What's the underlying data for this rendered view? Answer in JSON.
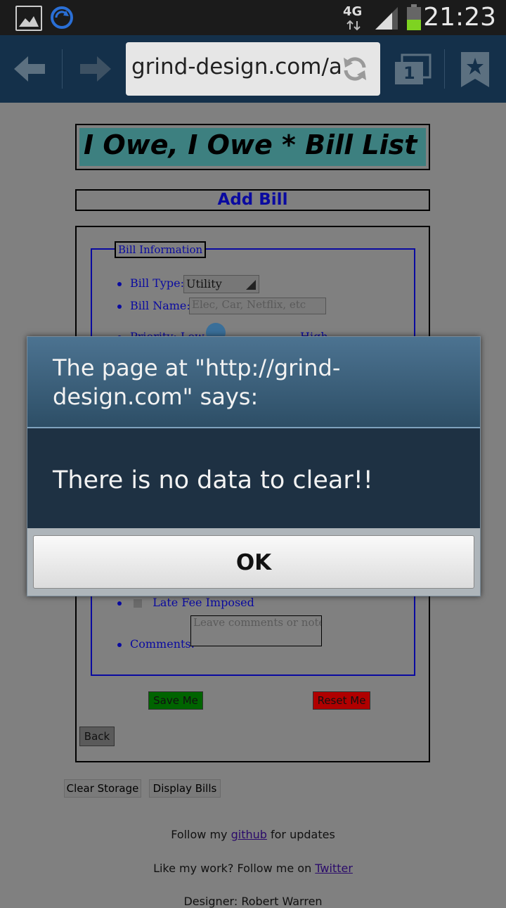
{
  "status_bar": {
    "network": "4G",
    "time": "21:23"
  },
  "browser": {
    "url": "grind-design.com/ac",
    "tab_count": "1"
  },
  "page": {
    "banner_title": "I Owe, I Owe * Bill List",
    "section_title": "Add Bill",
    "fieldset_legend": "Bill Information",
    "bill_type_label": "Bill Type:",
    "bill_type_value": "Utility",
    "bill_name_label": "Bill Name:",
    "bill_name_placeholder": "Elec, Car, Netflix, etc",
    "priority_label": "Priority: Low",
    "priority_high": "High",
    "late_fee_label": "Late Fee Imposed",
    "comments_label": "Comments:",
    "comments_placeholder": "Leave comments or note",
    "save_button": "Save Me",
    "reset_button": "Reset Me",
    "back_button": "Back",
    "clear_storage_button": "Clear Storage",
    "display_bills_button": "Display Bills",
    "follow_prefix": "Follow my ",
    "follow_link": "github",
    "follow_suffix": " for updates",
    "like_prefix": "Like my work? Follow me on ",
    "like_link": "Twitter",
    "designer": "Designer: Robert Warren"
  },
  "dialog": {
    "title": "The page at \"http://grind-design.com\" says:",
    "message": "There is no data to clear!!",
    "ok_button": "OK"
  },
  "colors": {
    "accent_blue": "#0a0aa0",
    "save_green": "#006400",
    "reset_red": "#b00000",
    "dialog_header": "#3d6583",
    "dialog_body": "#1e3143"
  }
}
